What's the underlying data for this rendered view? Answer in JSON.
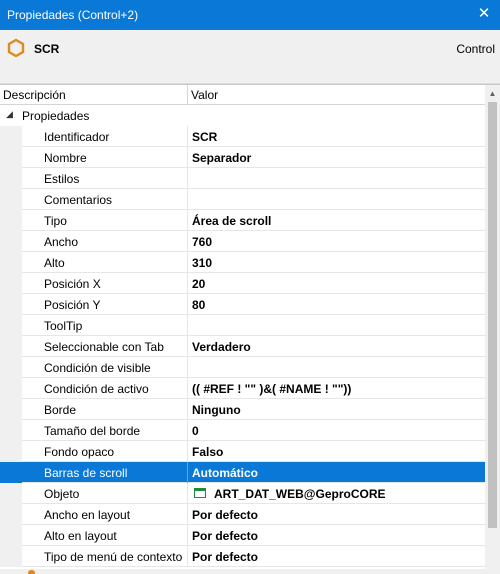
{
  "window": {
    "title": "Propiedades (Control+2)",
    "close_icon": "close-icon"
  },
  "header": {
    "object_name": "SCR",
    "object_type": "Control",
    "icon_color": "#e08a1e"
  },
  "grid": {
    "columns": {
      "name": "Descripción",
      "value": "Valor"
    },
    "category": "Propiedades",
    "rows": [
      {
        "name": "Identificador",
        "value": "SCR"
      },
      {
        "name": "Nombre",
        "value": "Separador"
      },
      {
        "name": "Estilos",
        "value": ""
      },
      {
        "name": "Comentarios",
        "value": ""
      },
      {
        "name": "Tipo",
        "value": "Área de scroll"
      },
      {
        "name": "Ancho",
        "value": "760"
      },
      {
        "name": "Alto",
        "value": "310"
      },
      {
        "name": "Posición X",
        "value": "20"
      },
      {
        "name": "Posición Y",
        "value": "80"
      },
      {
        "name": "ToolTip",
        "value": ""
      },
      {
        "name": "Seleccionable con Tab",
        "value": "Verdadero"
      },
      {
        "name": "Condición de visible",
        "value": ""
      },
      {
        "name": "Condición de activo",
        "value": "(( #REF ! \"\" )&( #NAME ! \"\"))"
      },
      {
        "name": "Borde",
        "value": "Ninguno"
      },
      {
        "name": "Tamaño del borde",
        "value": "0"
      },
      {
        "name": "Fondo opaco",
        "value": "Falso"
      },
      {
        "name": "Barras de scroll",
        "value": "Automático",
        "selected": true
      },
      {
        "name": "Objeto",
        "value": "ART_DAT_WEB@GeproCORE",
        "icon": "window-icon"
      },
      {
        "name": "Ancho en layout",
        "value": "Por defecto"
      },
      {
        "name": "Alto en layout",
        "value": "Por defecto"
      },
      {
        "name": "Tipo de menú de contexto",
        "value": "Por defecto"
      }
    ]
  },
  "colors": {
    "accent": "#0a78d7",
    "object_icon": "#1e8b3a"
  }
}
